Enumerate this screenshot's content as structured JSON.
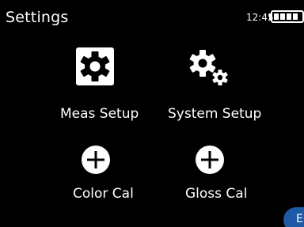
{
  "header": {
    "title": "Settings",
    "time": "12:45",
    "battery_icon": "battery-full-icon"
  },
  "menu": {
    "meas_setup": {
      "label": "Meas Setup",
      "icon": "gear-icon"
    },
    "system_setup": {
      "label": "System Setup",
      "icon": "gears-icon"
    },
    "color_cal": {
      "label": "Color Cal",
      "icon": "plus-circle-icon"
    },
    "gloss_cal": {
      "label": "Gloss Cal",
      "icon": "plus-circle-icon"
    }
  },
  "language_badge": {
    "label": "E"
  },
  "colors": {
    "background": "#000000",
    "text": "#ffffff",
    "badge": "#1f5aa6"
  }
}
